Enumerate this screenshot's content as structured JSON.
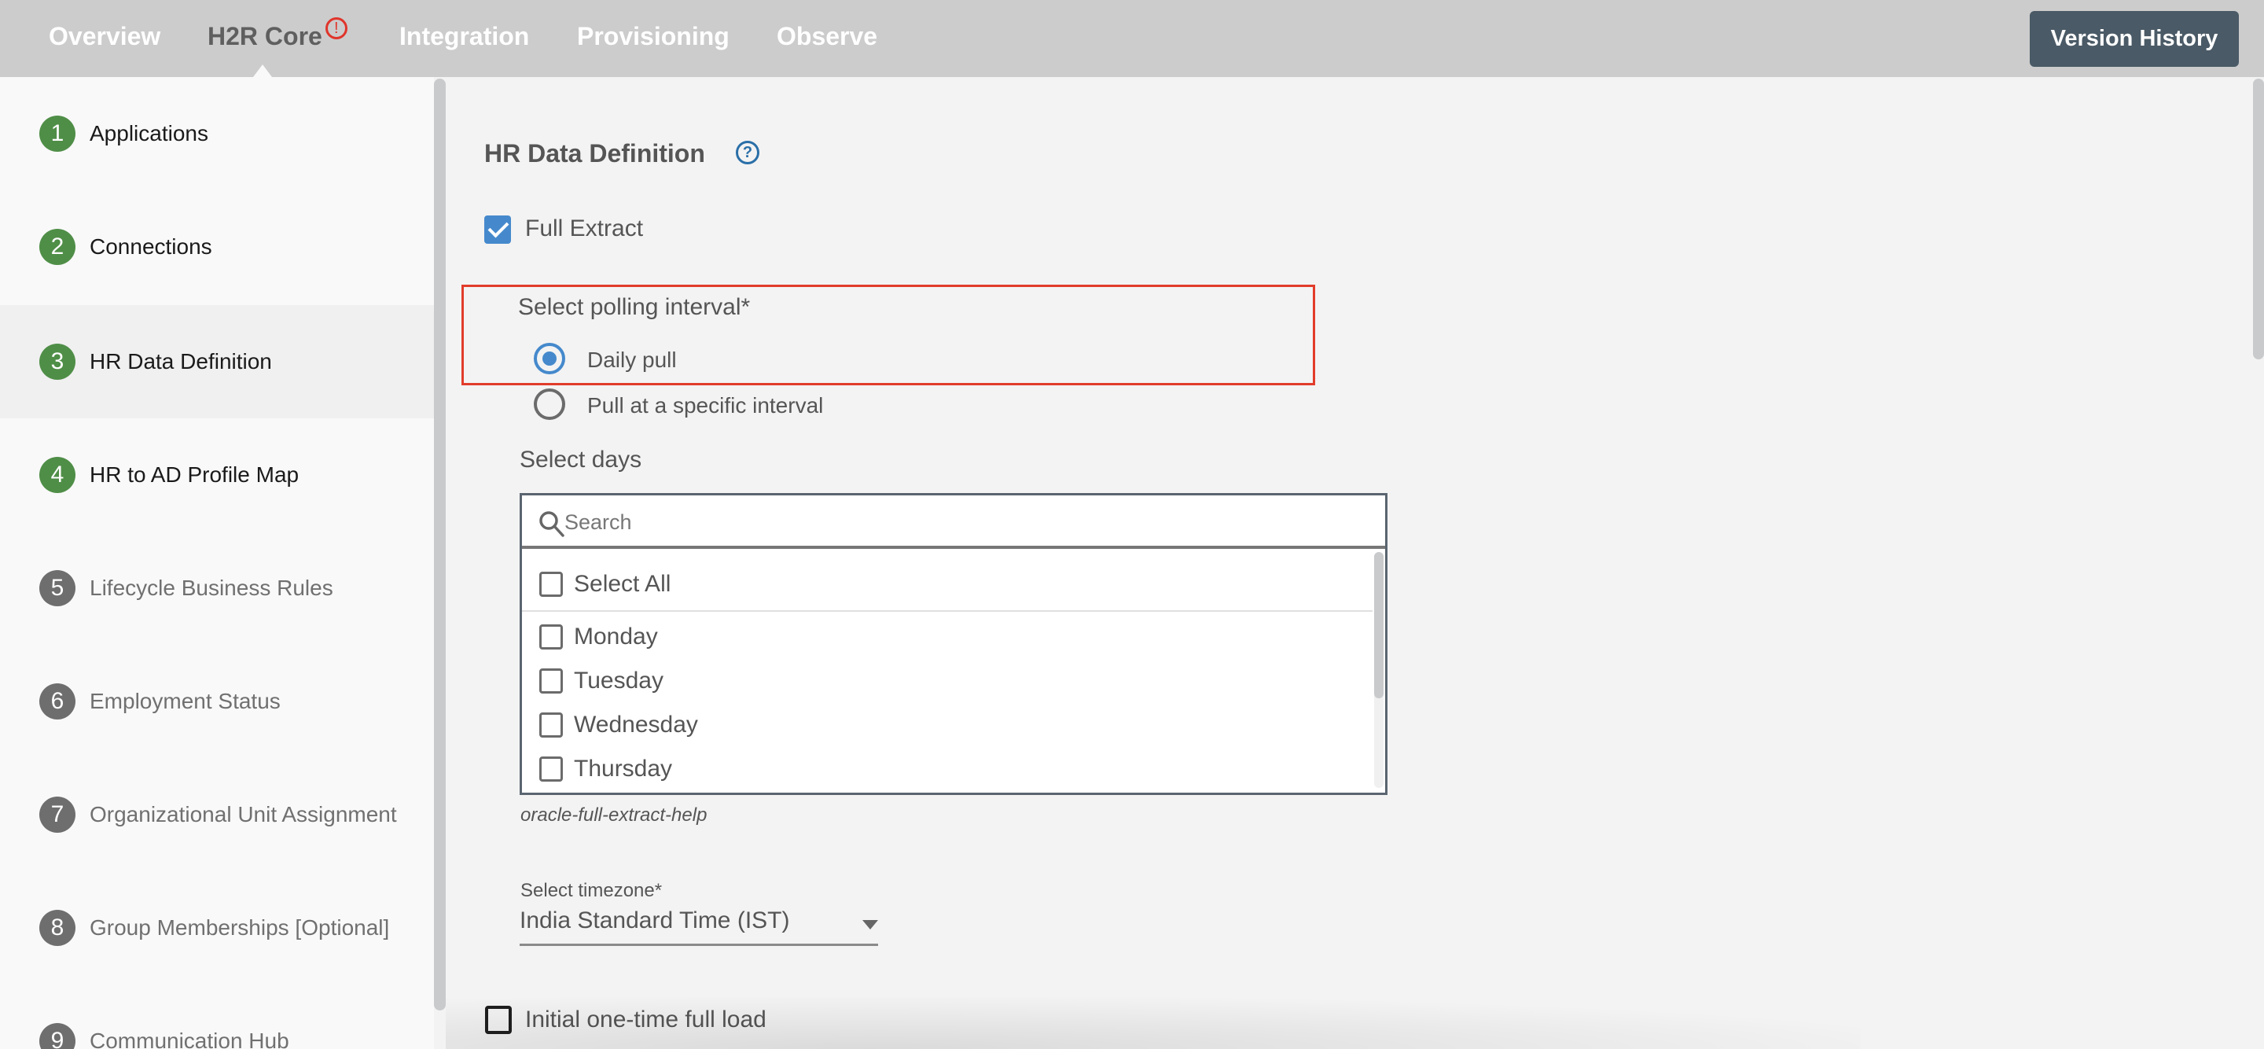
{
  "topnav": {
    "tabs": [
      {
        "label": "Overview",
        "active": false
      },
      {
        "label": "H2R Core",
        "active": true,
        "alert": "!"
      },
      {
        "label": "Integration",
        "active": false
      },
      {
        "label": "Provisioning",
        "active": false
      },
      {
        "label": "Observe",
        "active": false
      }
    ],
    "version_history_label": "Version History"
  },
  "sidebar": {
    "steps": [
      {
        "number": "1",
        "label": "Applications",
        "status": "done"
      },
      {
        "number": "2",
        "label": "Connections",
        "status": "done"
      },
      {
        "number": "3",
        "label": "HR Data Definition",
        "status": "done",
        "selected": true
      },
      {
        "number": "4",
        "label": "HR to AD Profile Map",
        "status": "done"
      },
      {
        "number": "5",
        "label": "Lifecycle Business Rules",
        "status": "todo"
      },
      {
        "number": "6",
        "label": "Employment Status",
        "status": "todo"
      },
      {
        "number": "7",
        "label": "Organizational Unit Assignment",
        "status": "todo"
      },
      {
        "number": "8",
        "label": "Group Memberships [Optional]",
        "status": "todo"
      },
      {
        "number": "9",
        "label": "Communication Hub",
        "status": "todo"
      }
    ]
  },
  "main": {
    "title": "HR Data Definition",
    "help_icon": "?",
    "full_extract": {
      "label": "Full Extract",
      "checked": true
    },
    "polling": {
      "label": "Select polling interval*",
      "options": [
        {
          "label": "Daily pull",
          "selected": true
        },
        {
          "label": "Pull at a specific interval",
          "selected": false
        }
      ]
    },
    "days": {
      "label": "Select days",
      "search_placeholder": "Search",
      "select_all": {
        "label": "Select All",
        "checked": false
      },
      "items": [
        {
          "label": "Monday",
          "checked": false
        },
        {
          "label": "Tuesday",
          "checked": false
        },
        {
          "label": "Wednesday",
          "checked": false
        },
        {
          "label": "Thursday",
          "checked": false
        }
      ]
    },
    "helper_text": "oracle-full-extract-help",
    "timezone": {
      "label": "Select timezone*",
      "value": "India Standard Time (IST)"
    },
    "initial_load": {
      "label": "Initial one-time full load",
      "checked": false
    }
  },
  "colors": {
    "accent": "#4589cc",
    "step_done": "#4f8e47",
    "step_todo": "#6e6e6e",
    "alert": "#e0352b",
    "highlight_border": "#e23c2b",
    "button_bg": "#4a5a66"
  }
}
